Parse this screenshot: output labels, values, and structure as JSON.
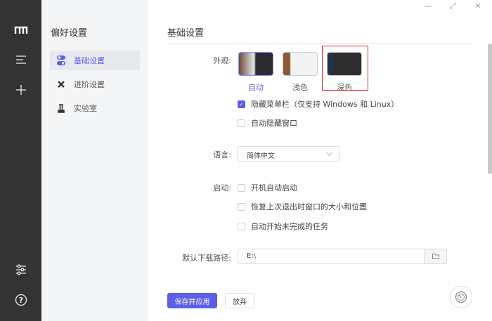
{
  "window": {
    "minimize": "—",
    "maximize": "⤢",
    "close": "✕"
  },
  "rail": {
    "logo": "m",
    "menu": "☰",
    "add": "+",
    "settings": "settings",
    "help": "?"
  },
  "nav": {
    "title": "偏好设置",
    "items": [
      {
        "label": "基础设置",
        "active": true
      },
      {
        "label": "进阶设置"
      },
      {
        "label": "实验室"
      }
    ]
  },
  "main": {
    "header": "基础设置",
    "appearance": {
      "label": "外观:",
      "options": [
        {
          "label": "自动",
          "selected": true
        },
        {
          "label": "浅色"
        },
        {
          "label": "深色"
        }
      ]
    },
    "hide_menubar": {
      "label": "隐藏菜单栏（仅支持 Windows 和 Linux）",
      "checked": true
    },
    "auto_hide_window": {
      "label": "自动隐藏窗口",
      "checked": false
    },
    "language": {
      "label": "语言:",
      "value": "简体中文"
    },
    "startup": {
      "label": "启动:",
      "options": [
        {
          "label": "开机自动启动",
          "checked": false
        },
        {
          "label": "恢复上次退出时窗口的大小和位置",
          "checked": false
        },
        {
          "label": "自动开始未完成的任务",
          "checked": false
        }
      ]
    },
    "download_path": {
      "label": "默认下载路径:",
      "value": "E:\\"
    },
    "save_label": "保存并应用",
    "discard_label": "放弃"
  },
  "colors": {
    "accent": "#5b5fe8",
    "rail": "#333333",
    "highlight": "#e0202a"
  }
}
